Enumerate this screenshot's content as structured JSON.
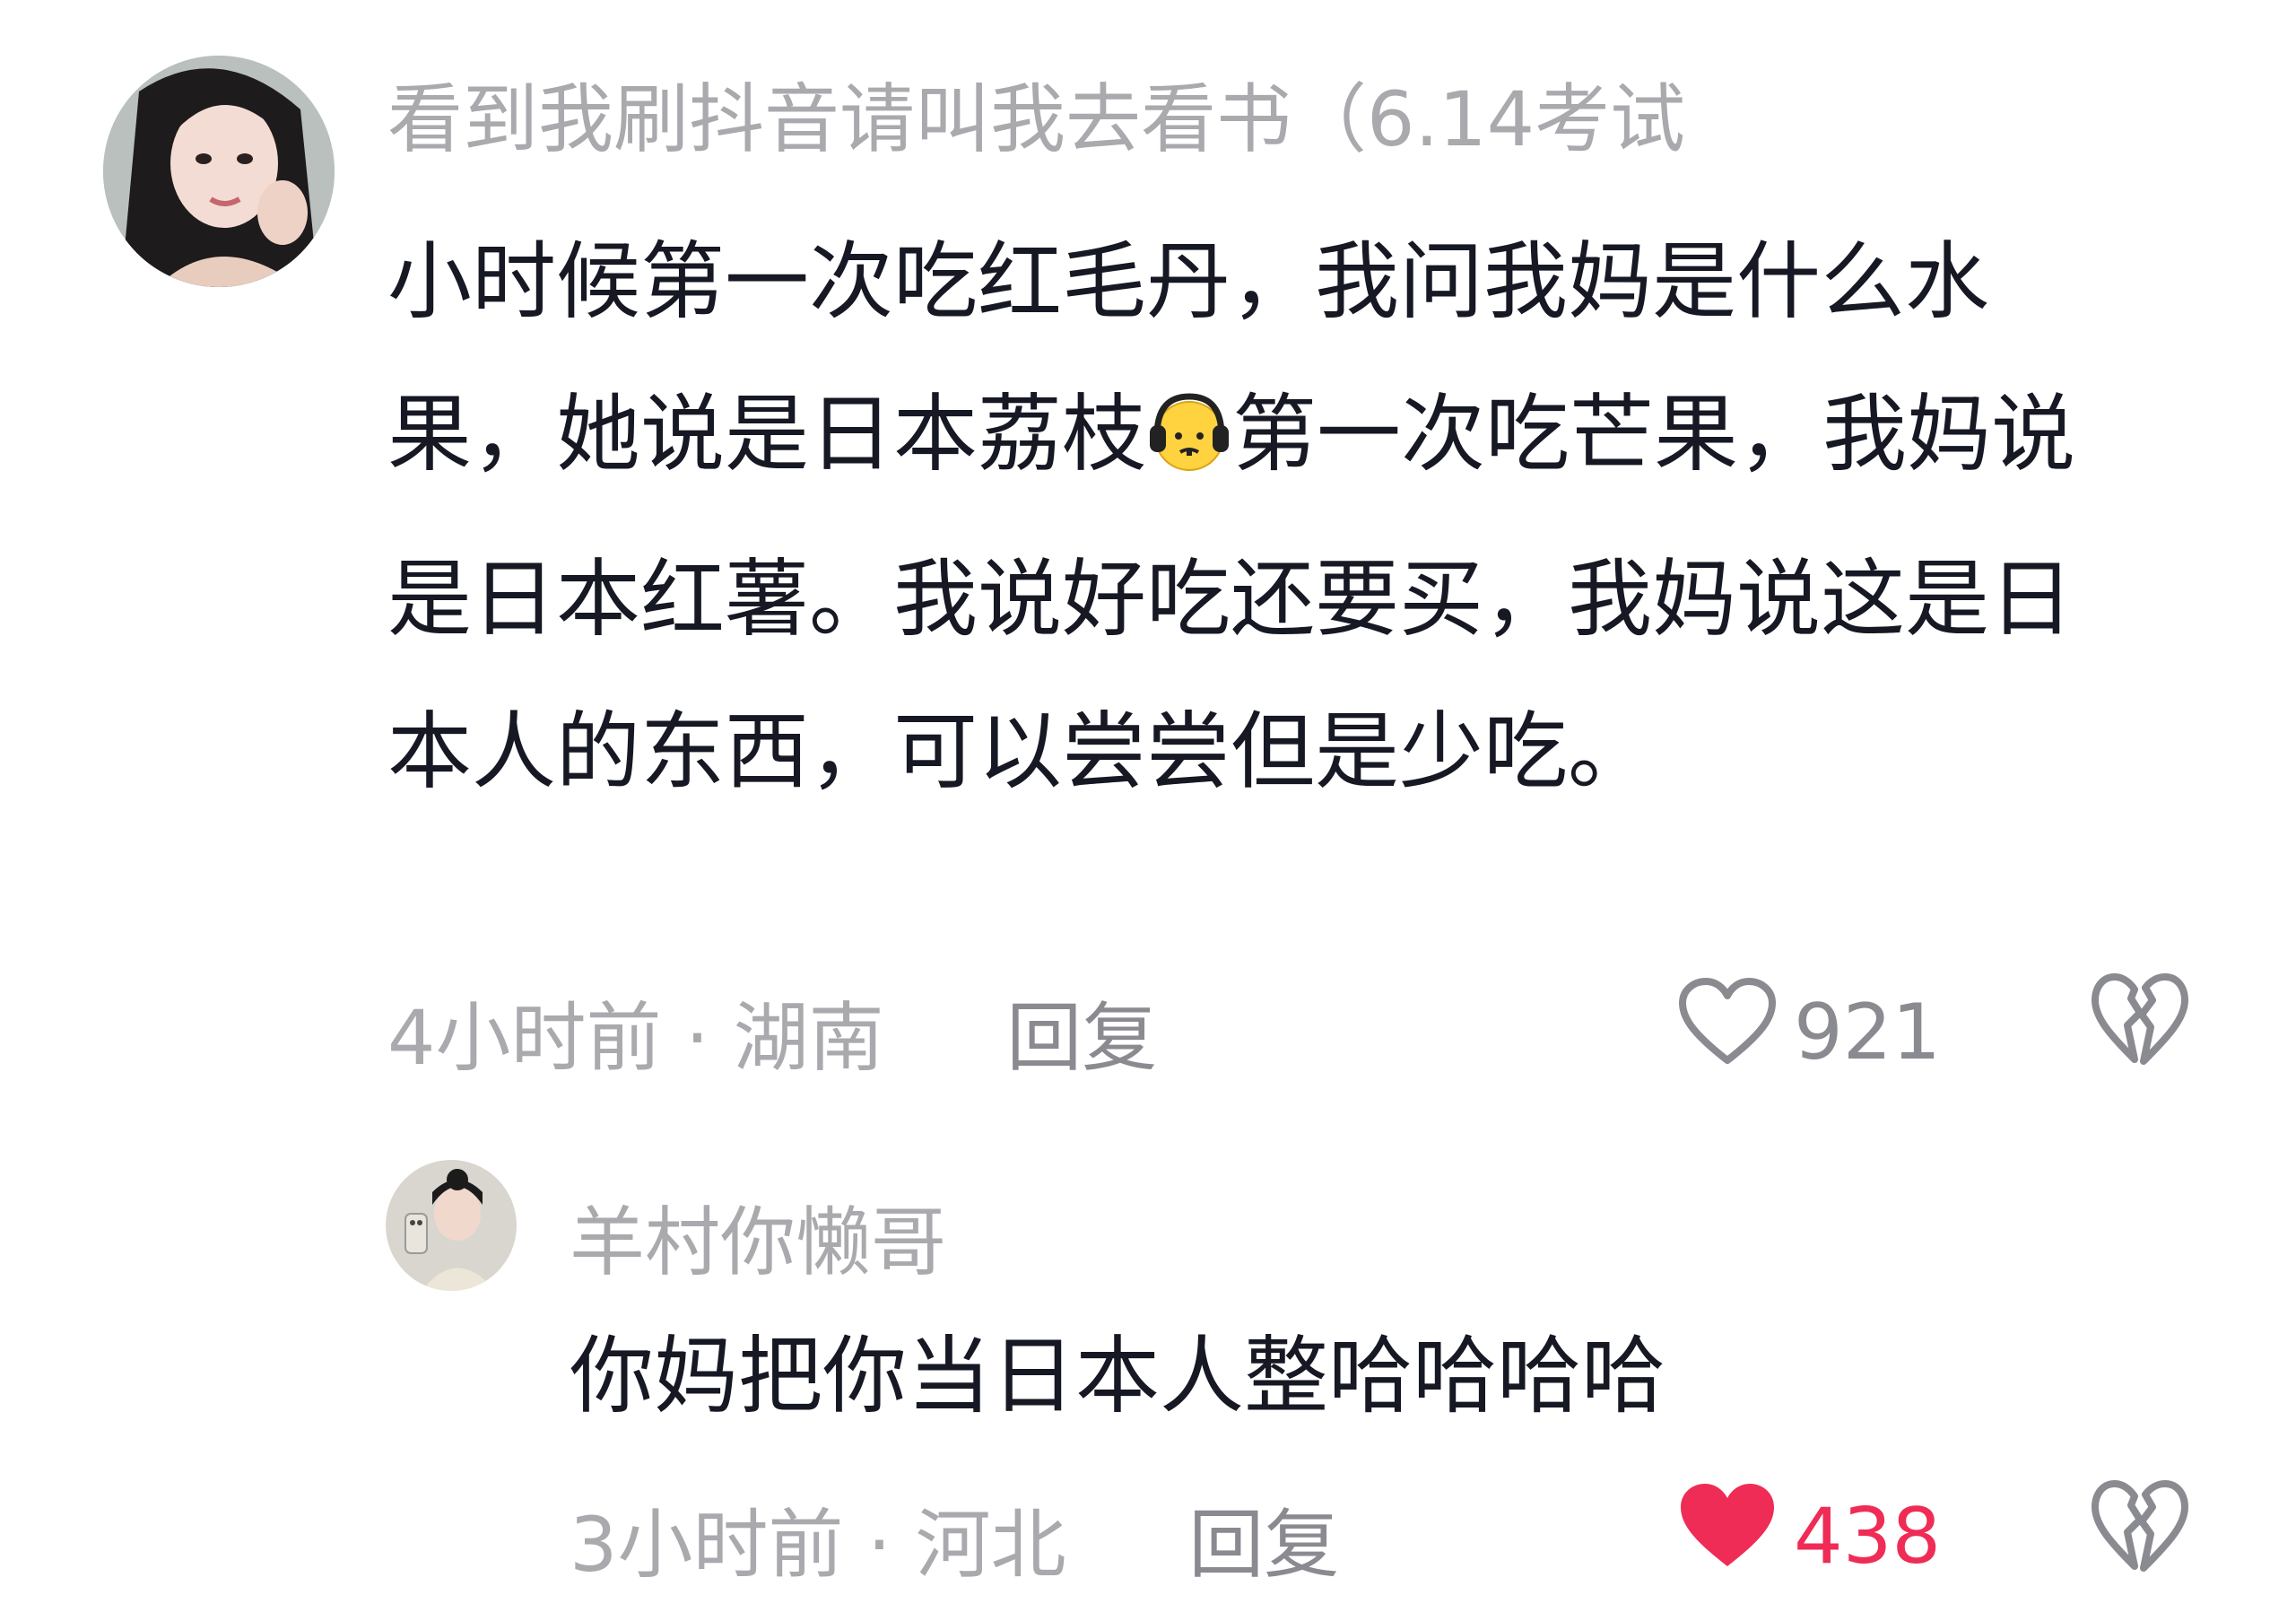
{
  "colors": {
    "text_primary": "#161823",
    "text_secondary": "#a9a9ae",
    "like_active": "#ef2c55"
  },
  "comment": {
    "username": "看到我刷抖音请叫我去看书（6.14考试",
    "text_before_emoji": "小时候第一次吃红毛丹，我问我妈是什么水果，她说是日本荔枝",
    "emoji": "headphones-face-emoji",
    "text_after_emoji": "第一次吃芒果，我妈说是日本红薯。我说好吃还要买，我妈说这是日本人的东西，可以尝尝但是少吃。",
    "time": "4小时前",
    "separator": "·",
    "location": "湖南",
    "reply_label": "回复",
    "like_count": "921",
    "liked": false
  },
  "reply": {
    "username": "羊村你懒哥",
    "text": "你妈把你当日本人整哈哈哈哈",
    "time": "3小时前",
    "separator": "·",
    "location": "河北",
    "reply_label": "回复",
    "like_count": "438",
    "liked": true
  }
}
